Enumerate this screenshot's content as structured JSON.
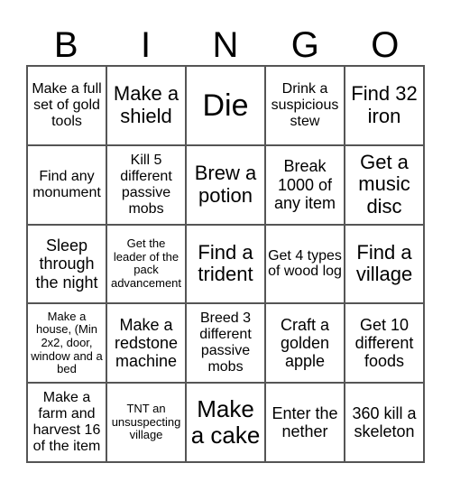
{
  "header": {
    "letters": [
      "B",
      "I",
      "N",
      "G",
      "O"
    ]
  },
  "cells": [
    "Make a full set of gold tools",
    "Make a shield",
    "Die",
    "Drink a suspicious stew",
    "Find 32 iron",
    "Find any monument",
    "Kill 5 different passive mobs",
    "Brew a potion",
    "Break 1000 of any item",
    "Get a music disc",
    "Sleep through the night",
    "Get the leader of the pack advancement",
    "Find a trident",
    "Get 4 types of wood log",
    "Find a village",
    "Make a house, (Min 2x2, door, window and a bed",
    "Make a redstone machine",
    "Breed 3 different passive mobs",
    "Craft a golden apple",
    "Get 10 different foods",
    "Make a farm and harvest 16 of the item",
    "TNT an unsuspecting village",
    "Make a cake",
    "Enter the nether",
    "360 kill a skeleton"
  ]
}
